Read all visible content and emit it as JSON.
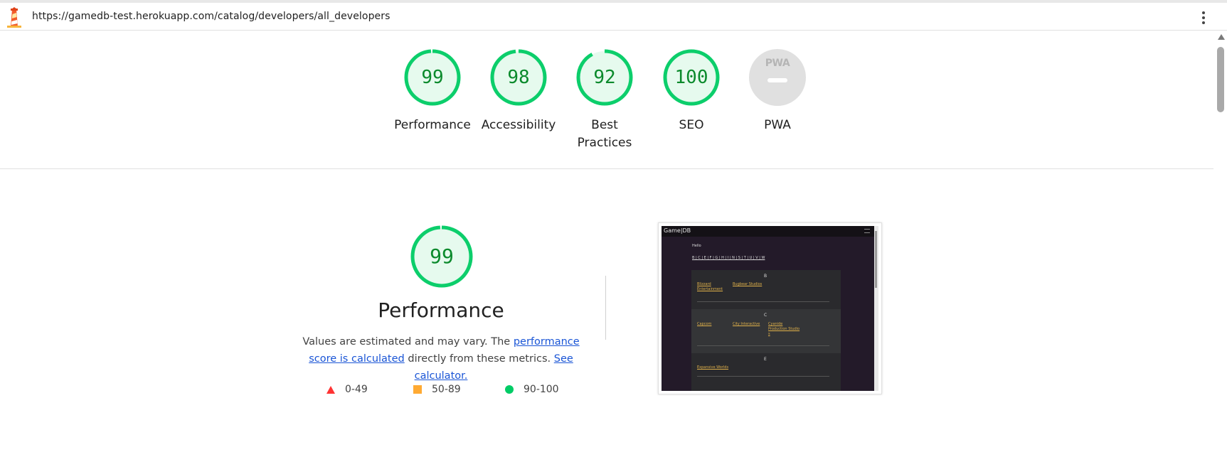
{
  "browser": {
    "url": "https://gamedb-test.herokuapp.com/catalog/developers/all_developers"
  },
  "gauges": [
    {
      "score": "99",
      "label": "Performance",
      "color": "#0cce6b"
    },
    {
      "score": "98",
      "label": "Accessibility",
      "color": "#0cce6b"
    },
    {
      "score": "92",
      "label": "Best Practices",
      "label_line1": "Best",
      "label_line2": "Practices",
      "color": "#0cce6b"
    },
    {
      "score": "100",
      "label": "SEO",
      "color": "#0cce6b"
    },
    {
      "score": "PWA",
      "label": "PWA",
      "color": "#e0e0e0"
    }
  ],
  "performance": {
    "score": "99",
    "title": "Performance",
    "desc_prefix": "Values are estimated and may vary. The ",
    "link_score": "performance score is calculated",
    "desc_middle": " directly from these metrics. ",
    "link_calc": "See calculator.",
    "legend": [
      {
        "range": "0-49",
        "icon": "red-triangle",
        "color": "#ff3333"
      },
      {
        "range": "50-89",
        "icon": "orange-square",
        "color": "#ffaa33"
      },
      {
        "range": "90-100",
        "icon": "green-circle",
        "color": "#00cc66"
      }
    ]
  },
  "thumbnail": {
    "logo": "Game|DB",
    "hello": "Hello",
    "letters": "B | C | E | F | G | H | I | N | S | T | U | V | W",
    "sections": [
      {
        "letter": "B",
        "links": [
          "Blizzard Entertainment",
          "Bugbear Studios"
        ]
      },
      {
        "letter": "C",
        "links": [
          "Capcom",
          "City Interactive",
          "Cyanide Production Studio s"
        ]
      },
      {
        "letter": "E",
        "links": [
          "Expansive Worlds"
        ]
      }
    ]
  }
}
